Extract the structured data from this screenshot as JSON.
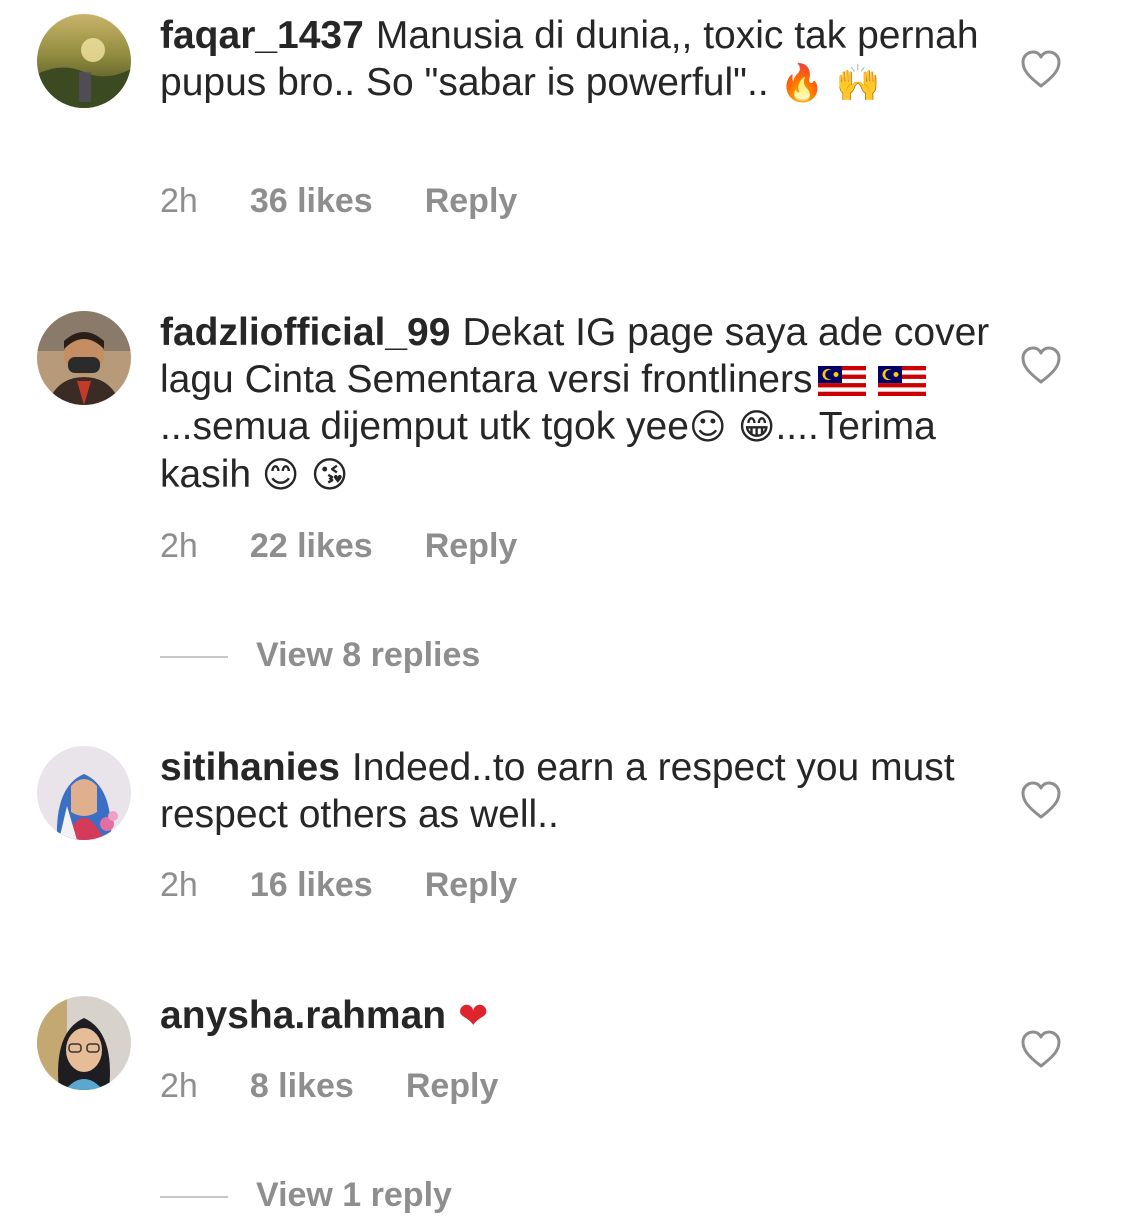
{
  "comments": [
    {
      "username": "faqar_1437",
      "text": "Manusia di dunia,, toxic tak pernah pupus bro.. So \"sabar is powerful\"..",
      "emoji": "🔥 🙌",
      "time": "2h",
      "likes": "36 likes",
      "reply": "Reply"
    },
    {
      "username": "fadzliofficial_99",
      "text_part1": "Dekat IG page saya ade cover lagu Cinta Sementara versi frontliners",
      "text_part2": "...semua dijemput utk tgok yee",
      "emoji1": "☺ 😁",
      "text_part3": "....Terima kasih",
      "emoji2": "😊 😘",
      "time": "2h",
      "likes": "22 likes",
      "reply": "Reply",
      "view_replies": "View 8 replies"
    },
    {
      "username": "sitihanies",
      "text": "Indeed..to earn a respect you must respect others as well..",
      "time": "2h",
      "likes": "16 likes",
      "reply": "Reply"
    },
    {
      "username": "anysha.rahman",
      "emoji": "❤",
      "time": "2h",
      "likes": "8 likes",
      "reply": "Reply",
      "view_replies": "View 1 reply"
    }
  ],
  "icons": {
    "like": "heart-outline-icon",
    "flag": "malaysia-flag-icon"
  },
  "colors": {
    "text": "#262626",
    "secondary": "#8e8e8e",
    "heart_red": "#e0242b"
  }
}
